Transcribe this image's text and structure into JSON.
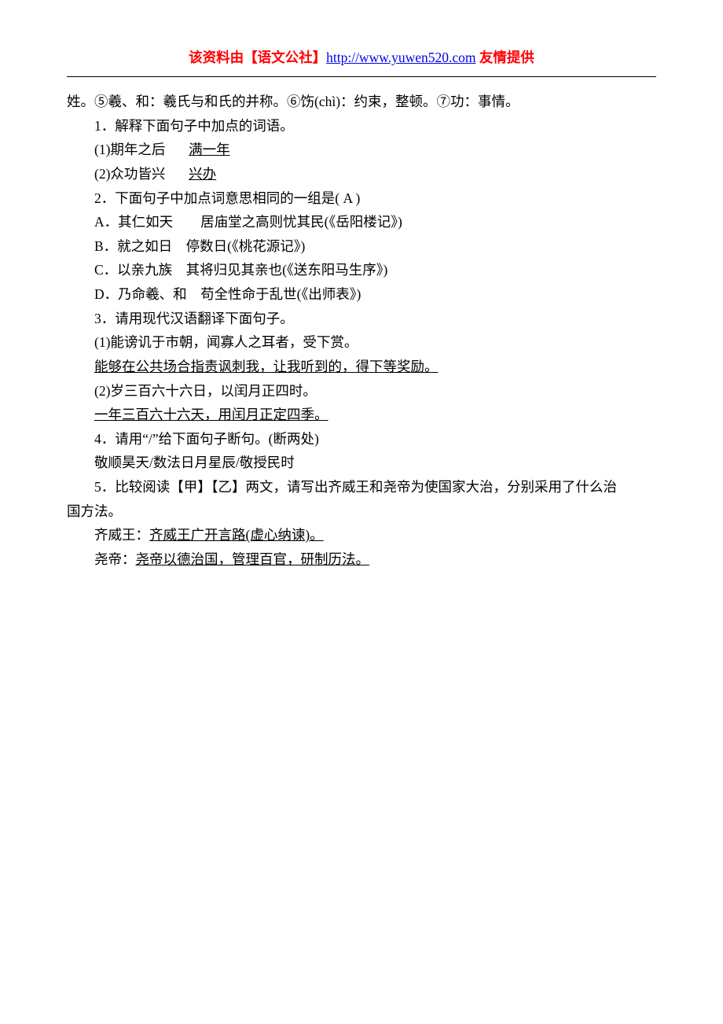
{
  "header": {
    "red_prefix": "该资料由【语文公社】",
    "link_text": "http://www.yuwen520.com",
    "link_href": "http://www.yuwen520.com",
    "red_suffix": " 友情提供"
  },
  "body": {
    "line0": "姓。⑤羲、和：羲氏与和氏的并称。⑥饬(chì)：约束，整顿。⑦功：事情。",
    "q1": {
      "prompt": "1．解释下面句子中加点的词语。",
      "opt1_text": "(1)期年之后",
      "opt1_ans": "满一年",
      "opt2_text": "(2)众功皆兴",
      "opt2_ans": "兴办"
    },
    "q2": {
      "prompt": "2．下面句子中加点词意思相同的一组是( A )",
      "opt_a": "A．其仁如天　　居庙堂之高则忧其民(《岳阳楼记》)",
      "opt_b": "B．就之如日　停数日(《桃花源记》)",
      "opt_c": "C．以亲九族　其将归见其亲也(《送东阳马生序》)",
      "opt_d": "D．乃命羲、和　苟全性命于乱世(《出师表》)"
    },
    "q3": {
      "prompt": "3．请用现代汉语翻译下面句子。",
      "s1_text": "(1)能谤讥于市朝，闻寡人之耳者，受下赏。",
      "s1_ans": "能够在公共场合指责讽刺我，让我听到的，得下等奖励。",
      "s2_text": "(2)岁三百六十六日，以闰月正四时。",
      "s2_ans": "一年三百六十六天，用闰月正定四季。"
    },
    "q4": {
      "prompt": "4．请用“/”给下面句子断句。(断两处)",
      "ans": "敬顺昊天/数法日月星辰/敬授民时"
    },
    "q5": {
      "prompt": "5．比较阅读【甲】【乙】两文，请写出齐威王和尧帝为使国家大治，分别采用了什么治",
      "prompt_cont": "国方法。",
      "a1_label": "齐威王：",
      "a1_ans": "齐威王广开言路(虚心纳谏)。",
      "a2_label": "尧帝：",
      "a2_ans": "尧帝以德治国，管理百官，研制历法。"
    }
  }
}
